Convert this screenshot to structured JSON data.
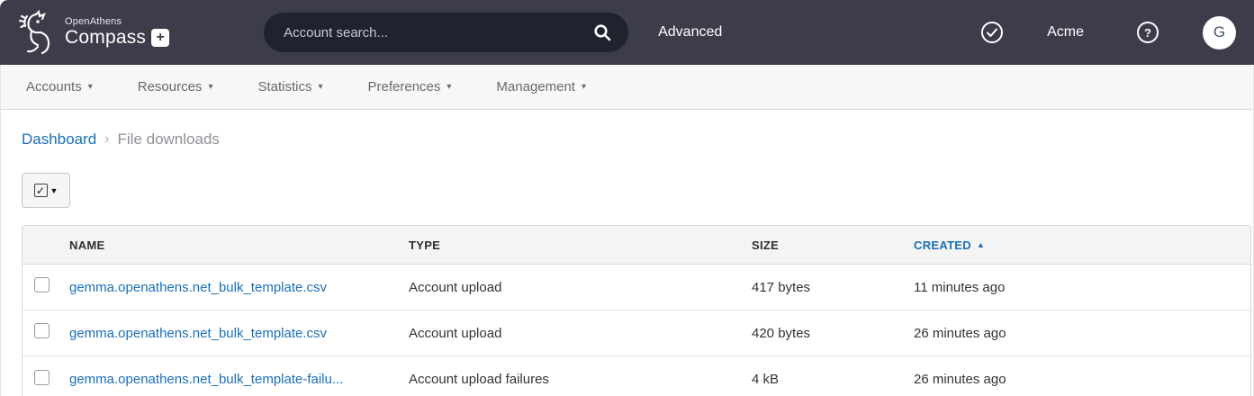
{
  "header": {
    "brand_top": "OpenAthens",
    "brand_name": "Compass",
    "plus_glyph": "+",
    "search_placeholder": "Account search...",
    "advanced_label": "Advanced",
    "org_name": "Acme",
    "avatar_initial": "G"
  },
  "nav": {
    "caret": "▾",
    "items": [
      {
        "label": "Accounts"
      },
      {
        "label": "Resources"
      },
      {
        "label": "Statistics"
      },
      {
        "label": "Preferences"
      },
      {
        "label": "Management"
      }
    ]
  },
  "breadcrumb": {
    "link": "Dashboard",
    "separator": "›",
    "current": "File downloads"
  },
  "toolbar": {
    "select_check": "✓",
    "select_caret": "▼"
  },
  "table": {
    "columns": {
      "name": "NAME",
      "type": "TYPE",
      "size": "SIZE",
      "created": "CREATED"
    },
    "sort": {
      "column": "CREATED",
      "direction": "asc",
      "arrow": "▲"
    },
    "rows": [
      {
        "name": "gemma.openathens.net_bulk_template.csv",
        "type": "Account upload",
        "size": "417 bytes",
        "created": "11 minutes ago"
      },
      {
        "name": "gemma.openathens.net_bulk_template.csv",
        "type": "Account upload",
        "size": "420 bytes",
        "created": "26 minutes ago"
      },
      {
        "name": "gemma.openathens.net_bulk_template-failu...",
        "type": "Account upload failures",
        "size": "4 kB",
        "created": "26 minutes ago"
      }
    ]
  },
  "colors": {
    "header_bg": "#3c3c4b",
    "search_bg": "#20232e",
    "link_blue": "#1a6fba",
    "nav_bg": "#f7f7f7",
    "table_border": "#d9d9d9"
  }
}
